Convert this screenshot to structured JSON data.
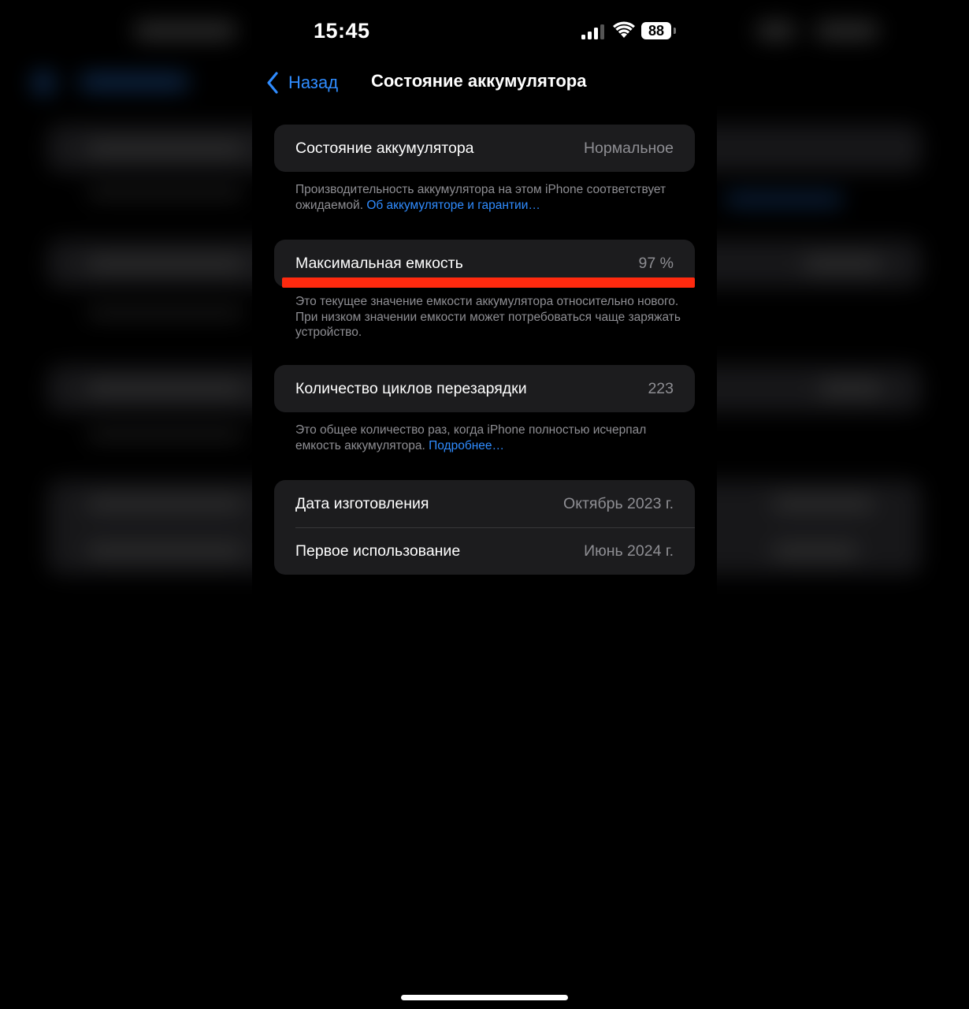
{
  "status_bar": {
    "time": "15:45",
    "battery_level": "88",
    "signal_bars_active": 3,
    "signal_bars_total": 4
  },
  "nav": {
    "back_label": "Назад",
    "title": "Состояние аккумулятора"
  },
  "battery_condition": {
    "label": "Состояние аккумулятора",
    "value": "Нормальное",
    "footnote": "Производительность аккумулятора на этом iPhone соответствует ожидаемой.",
    "footnote_link": "Об аккумуляторе и гарантии…"
  },
  "max_capacity": {
    "label": "Максимальная емкость",
    "value": "97 %",
    "footnote": "Это текущее значение емкости аккумулятора относительно нового. При низком значении емкости может потребоваться чаще заряжать устройство."
  },
  "cycle_count": {
    "label": "Количество циклов перезарядки",
    "value": "223",
    "footnote": "Это общее количество раз, когда iPhone полностью исчерпал емкость аккумулятора.",
    "footnote_link": "Подробнее…"
  },
  "dates": [
    {
      "label": "Дата изготовления",
      "value": "Октябрь 2023 г."
    },
    {
      "label": "Первое использование",
      "value": "Июнь 2024 г."
    }
  ],
  "colors": {
    "accent": "#2f8cff",
    "highlight": "#ff2a0f",
    "card": "#1c1c1e",
    "secondary_text": "#8e8e93"
  }
}
